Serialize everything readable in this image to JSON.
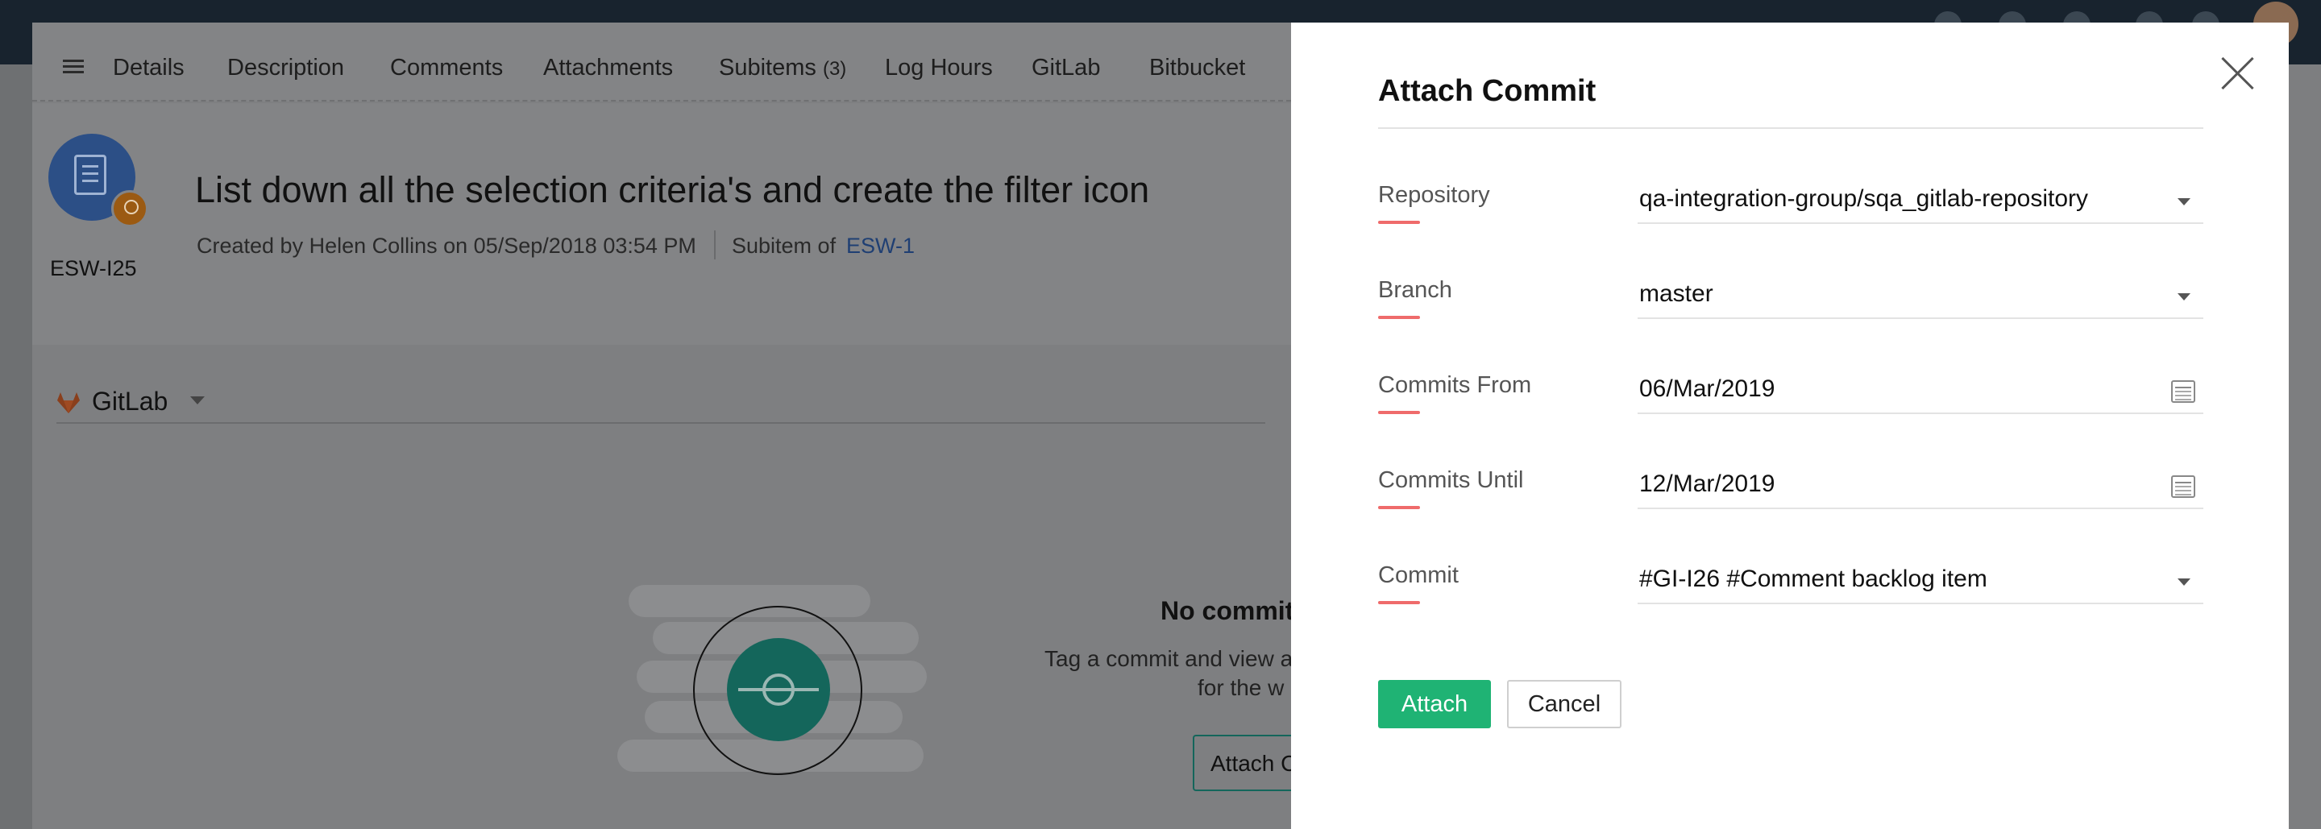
{
  "tabs": [
    {
      "label": "Details"
    },
    {
      "label": "Description"
    },
    {
      "label": "Comments"
    },
    {
      "label": "Attachments"
    },
    {
      "label": "Subitems",
      "count": "(3)"
    },
    {
      "label": "Log Hours"
    },
    {
      "label": "GitLab"
    },
    {
      "label": "Bitbucket"
    }
  ],
  "item": {
    "key": "ESW-I25",
    "title": "List down all the selection criteria's and create the filter icon",
    "created": "Created by Helen Collins on 05/Sep/2018 03:54 PM",
    "subitem_of_label": "Subitem of",
    "parent_link": "ESW-1",
    "icon": "document-check-icon",
    "owner_icon": "user-badge-icon"
  },
  "integration": {
    "label": "GitLab",
    "icon": "gitlab-icon"
  },
  "empty_state": {
    "title": "No commit",
    "desc_line1": "Tag a commit and view a",
    "desc_line2": "for the w",
    "button": "Attach C"
  },
  "drawer": {
    "title": "Attach Commit",
    "fields": [
      {
        "label": "Repository",
        "value": "qa-integration-group/sqa_gitlab-repository",
        "control": "dropdown"
      },
      {
        "label": "Branch",
        "value": "master",
        "control": "dropdown"
      },
      {
        "label": "Commits From",
        "value": "06/Mar/2019",
        "control": "date"
      },
      {
        "label": "Commits Until",
        "value": "12/Mar/2019",
        "control": "date"
      },
      {
        "label": "Commit",
        "value": "#GI-I26 #Comment backlog item",
        "control": "dropdown"
      }
    ],
    "attach_label": "Attach",
    "cancel_label": "Cancel"
  },
  "colors": {
    "accent_green": "#1fb374",
    "field_underline": "#ef6b6b",
    "topbar": "#18232e",
    "link": "#1f3f73"
  }
}
